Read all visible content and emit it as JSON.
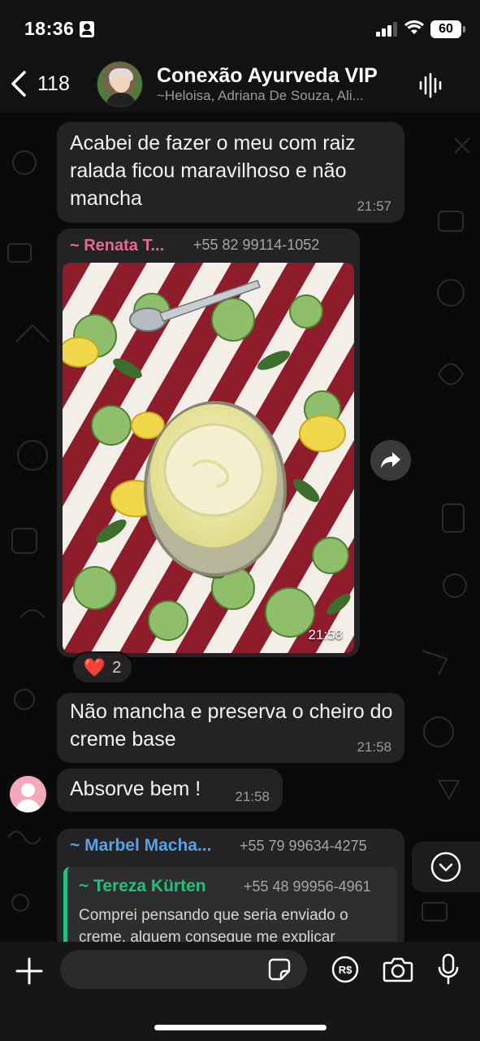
{
  "status_bar": {
    "time": "18:36",
    "battery": "60"
  },
  "header": {
    "back_count": "118",
    "title": "Conexão Ayurveda VIP",
    "members": "~Heloisa, Adriana De Souza, Ali..."
  },
  "messages": [
    {
      "text": "Acabei de fazer o meu com raiz ralada ficou maravilhoso e não mancha",
      "time": "21:57"
    },
    {
      "sender": "~ Renata T...",
      "sender_phone": "+55 82 99114-1052",
      "type": "image",
      "time": "21:58",
      "reaction": {
        "emoji": "❤️",
        "count": "2"
      }
    },
    {
      "text": "Não mancha e preserva o cheiro do creme base",
      "time": "21:58"
    },
    {
      "text": "Absorve bem !",
      "time": "21:58"
    },
    {
      "sender": "~ Marbel Macha...",
      "sender_phone": "+55 79 99634-4275",
      "quote": {
        "sender": "~ Tereza Kürten",
        "sender_phone": "+55 48 99956-4961",
        "text": "Comprei pensando que seria enviado o creme, alguem consegue me explicar"
      }
    }
  ],
  "input_bar": {
    "placeholder": ""
  },
  "colors": {
    "renata": "#e86a89",
    "marbel": "#5aa2e6",
    "tereza": "#21c17a",
    "bubble": "#232325"
  }
}
